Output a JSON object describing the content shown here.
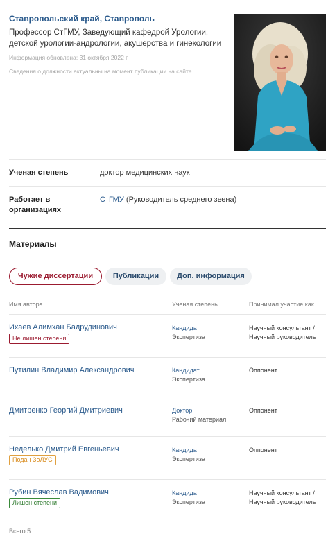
{
  "profile": {
    "region": "Ставропольский край, Ставрополь",
    "position": "Профессор СтГМУ, Заведующий кафедрой Урологии, детской урологии-андрологии, акушерства и гинекологии",
    "updated": "Информация обновлена: 31 октября 2022 г.",
    "note": "Сведения о должности актуальны на момент публикации на сайте"
  },
  "fields": {
    "degree_label": "Ученая степень",
    "degree_value": "доктор медицинских наук",
    "works_label": "Работает в организациях",
    "works_org": "СтГМУ",
    "works_role": " (Руководитель среднего звена)"
  },
  "materials": {
    "title": "Материалы",
    "tabs": [
      "Чужие диссертации",
      "Публикации",
      "Доп. информация"
    ]
  },
  "table": {
    "headers": [
      "Имя автора",
      "Ученая степень",
      "Принимал участие как"
    ],
    "rows": [
      {
        "name": "Ихаев Алимхан Бадрудинович",
        "badge": "Не лишен степени",
        "degree": "Кандидат",
        "type": "Экспертиза",
        "role": "Научный консультант / Научный руководитель"
      },
      {
        "name": "Путилин Владимир Александрович",
        "badge": "",
        "degree": "Кандидат",
        "type": "Экспертиза",
        "role": "Оппонент"
      },
      {
        "name": "Дмитренко Георгий Дмитриевич",
        "badge": "",
        "degree": "Доктор",
        "type": "Рабочий материал",
        "role": "Оппонент"
      },
      {
        "name": "Неделько Дмитрий Евгеньевич",
        "badge": "Подан ЗоЛУС",
        "degree": "Кандидат",
        "type": "Экспертиза",
        "role": "Оппонент"
      },
      {
        "name": "Рубин Вячеслав Вадимович",
        "badge": "Лишен степени",
        "degree": "Кандидат",
        "type": "Экспертиза",
        "role": "Научный консультант / Научный руководитель"
      }
    ],
    "total": "Всего 5"
  },
  "colors": {
    "link": "#2a5a8c",
    "accent": "#9b1b30",
    "badge_orange": "#d88a1a",
    "badge_green": "#2d7a2d"
  }
}
